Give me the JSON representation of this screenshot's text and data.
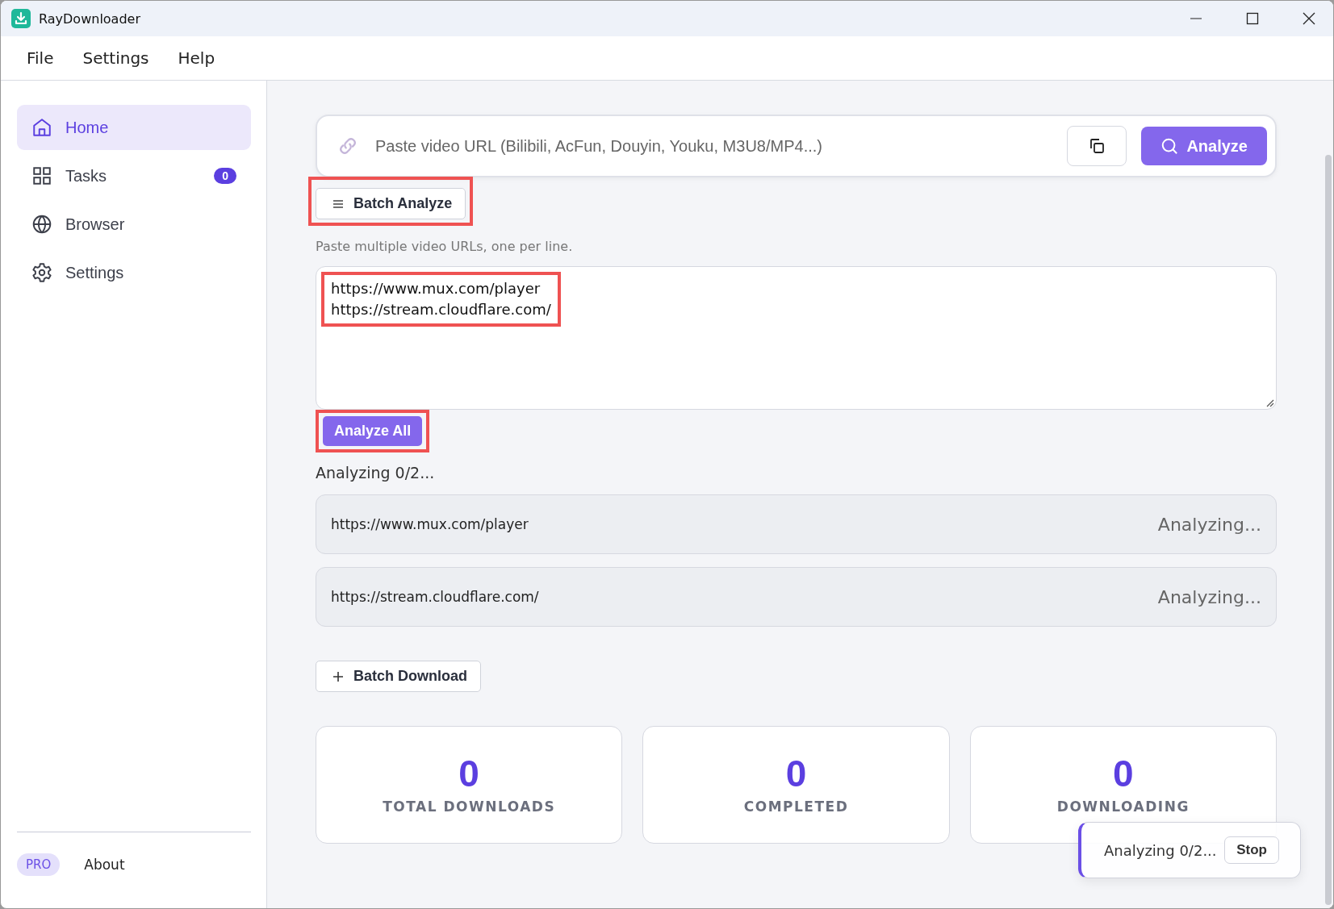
{
  "window": {
    "title": "RayDownloader"
  },
  "menu": [
    "File",
    "Settings",
    "Help"
  ],
  "sidebar": {
    "items": [
      {
        "label": "Home",
        "kind": "home",
        "selected": true
      },
      {
        "label": "Tasks",
        "kind": "tasks",
        "selected": false,
        "badge": "0"
      },
      {
        "label": "Browser",
        "kind": "browser",
        "selected": false
      },
      {
        "label": "Settings",
        "kind": "settings",
        "selected": false
      }
    ],
    "footer": {
      "badge": "PRO",
      "link": "About"
    }
  },
  "url_bar": {
    "placeholder": "Paste video URL (Bilibili, AcFun, Douyin, Youku, M3U8/MP4...)",
    "button": "Analyze"
  },
  "batch": {
    "toggle": {
      "label": "Batch Analyze",
      "highlighted": true
    },
    "hint": "Paste multiple video URLs, one per line.",
    "urls": {
      "value": "https://www.mux.com/player\nhttps://stream.cloudflare.com/",
      "highlighted": true
    },
    "analyze_all": {
      "label": "Analyze All",
      "highlighted": true
    },
    "progress": "Analyzing 0/2...",
    "results": [
      {
        "url": "https://www.mux.com/player",
        "status": "Analyzing..."
      },
      {
        "url": "https://stream.cloudflare.com/",
        "status": "Analyzing..."
      }
    ],
    "download_button": "Batch Download"
  },
  "stats": [
    {
      "value": "0",
      "label": "TOTAL DOWNLOADS"
    },
    {
      "value": "0",
      "label": "COMPLETED"
    },
    {
      "value": "0",
      "label": "DOWNLOADING"
    }
  ],
  "toast": {
    "text": "Analyzing 0/2...",
    "button": "Stop"
  }
}
